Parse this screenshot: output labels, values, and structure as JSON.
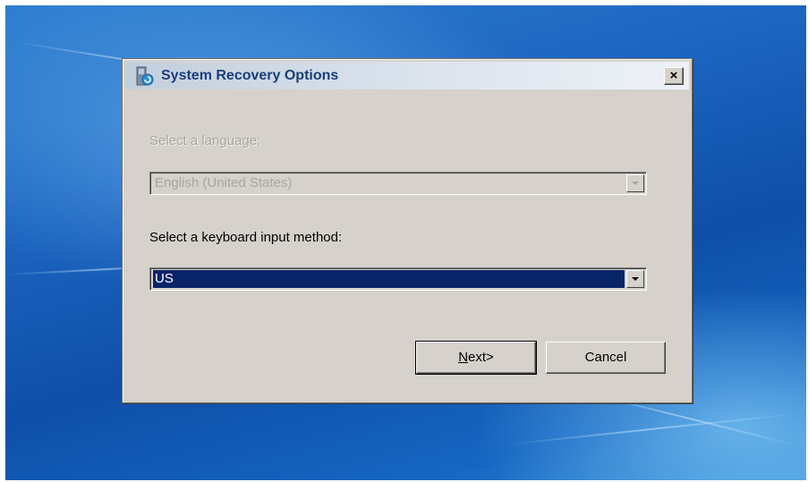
{
  "dialog": {
    "title": "System Recovery Options",
    "close_glyph": "×",
    "title_icon": "system-recovery-icon"
  },
  "language": {
    "label": "Select a language:",
    "value": "English (United States)",
    "enabled": false
  },
  "keyboard": {
    "label": "Select a keyboard input method:",
    "value": "US",
    "enabled": true
  },
  "buttons": {
    "next_access_key": "N",
    "next_rest": "ext>",
    "cancel": "Cancel"
  },
  "colors": {
    "dialog_face": "#d6d2cb",
    "selection": "#0a246a",
    "title_text": "#1a3f7a"
  }
}
